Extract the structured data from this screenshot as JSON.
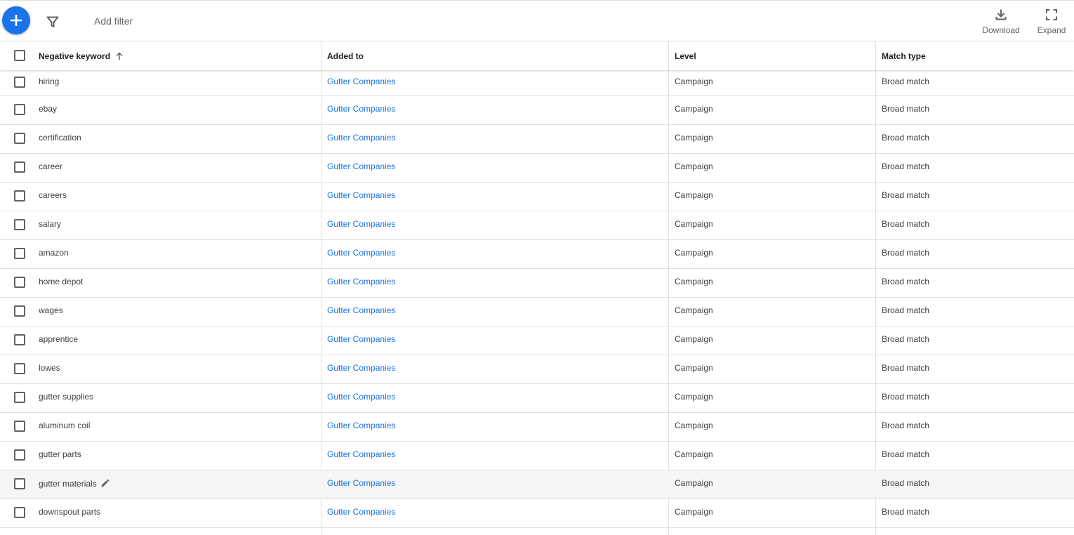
{
  "toolbar": {
    "add_icon": "plus-icon",
    "filter_icon": "filter-icon",
    "add_filter_label": "Add filter",
    "download_label": "Download",
    "download_icon": "download-icon",
    "expand_label": "Expand",
    "expand_icon": "fullscreen-icon"
  },
  "colors": {
    "accent": "#1a73e8",
    "link": "#1a73e8"
  },
  "table": {
    "columns": [
      "Negative keyword",
      "Added to",
      "Level",
      "Match type"
    ],
    "sort_column": "Negative keyword",
    "sort_icon": "arrow-up-icon",
    "rows": [
      {
        "keyword": "hiring",
        "added_to": "Gutter Companies",
        "level": "Campaign",
        "match_type": "Broad match"
      },
      {
        "keyword": "ebay",
        "added_to": "Gutter Companies",
        "level": "Campaign",
        "match_type": "Broad match"
      },
      {
        "keyword": "certification",
        "added_to": "Gutter Companies",
        "level": "Campaign",
        "match_type": "Broad match"
      },
      {
        "keyword": "career",
        "added_to": "Gutter Companies",
        "level": "Campaign",
        "match_type": "Broad match"
      },
      {
        "keyword": "careers",
        "added_to": "Gutter Companies",
        "level": "Campaign",
        "match_type": "Broad match"
      },
      {
        "keyword": "salary",
        "added_to": "Gutter Companies",
        "level": "Campaign",
        "match_type": "Broad match"
      },
      {
        "keyword": "amazon",
        "added_to": "Gutter Companies",
        "level": "Campaign",
        "match_type": "Broad match"
      },
      {
        "keyword": "home depot",
        "added_to": "Gutter Companies",
        "level": "Campaign",
        "match_type": "Broad match"
      },
      {
        "keyword": "wages",
        "added_to": "Gutter Companies",
        "level": "Campaign",
        "match_type": "Broad match"
      },
      {
        "keyword": "apprentice",
        "added_to": "Gutter Companies",
        "level": "Campaign",
        "match_type": "Broad match"
      },
      {
        "keyword": "lowes",
        "added_to": "Gutter Companies",
        "level": "Campaign",
        "match_type": "Broad match"
      },
      {
        "keyword": "gutter supplies",
        "added_to": "Gutter Companies",
        "level": "Campaign",
        "match_type": "Broad match"
      },
      {
        "keyword": "aluminum coil",
        "added_to": "Gutter Companies",
        "level": "Campaign",
        "match_type": "Broad match"
      },
      {
        "keyword": "gutter parts",
        "added_to": "Gutter Companies",
        "level": "Campaign",
        "match_type": "Broad match"
      },
      {
        "keyword": "gutter materials",
        "added_to": "Gutter Companies",
        "level": "Campaign",
        "match_type": "Broad match",
        "hovered": true,
        "edit_icon": "pencil-icon"
      },
      {
        "keyword": "downspout parts",
        "added_to": "Gutter Companies",
        "level": "Campaign",
        "match_type": "Broad match"
      }
    ]
  }
}
